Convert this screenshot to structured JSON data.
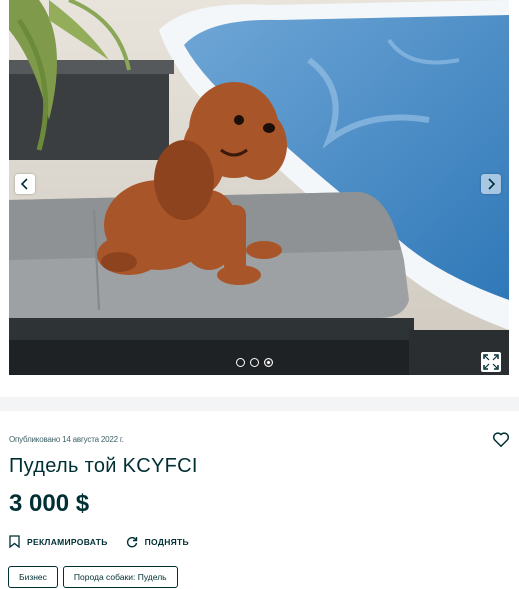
{
  "gallery": {
    "image_alt": "Пудель той KCYFCI",
    "prev_icon": "chevron-left-icon",
    "next_icon": "chevron-right-icon",
    "expand_icon": "expand-icon",
    "photo_count": 3,
    "active_photo_index": 2
  },
  "listing": {
    "published": "Опубликовано 14 августа 2022 г.",
    "favorite_icon": "heart-icon",
    "title": "Пудель той KCYFCI",
    "price": "3 000 $"
  },
  "actions": {
    "promote_label": "РЕКЛАМИРОВАТЬ",
    "promote_icon": "bookmark-icon",
    "raise_label": "ПОДНЯТЬ",
    "raise_icon": "refresh-icon"
  },
  "tags": [
    {
      "label": "Бизнес"
    },
    {
      "label": "Порода собаки: Пудель"
    }
  ],
  "colors": {
    "text": "#002f34",
    "band": "#f2f4f5"
  }
}
